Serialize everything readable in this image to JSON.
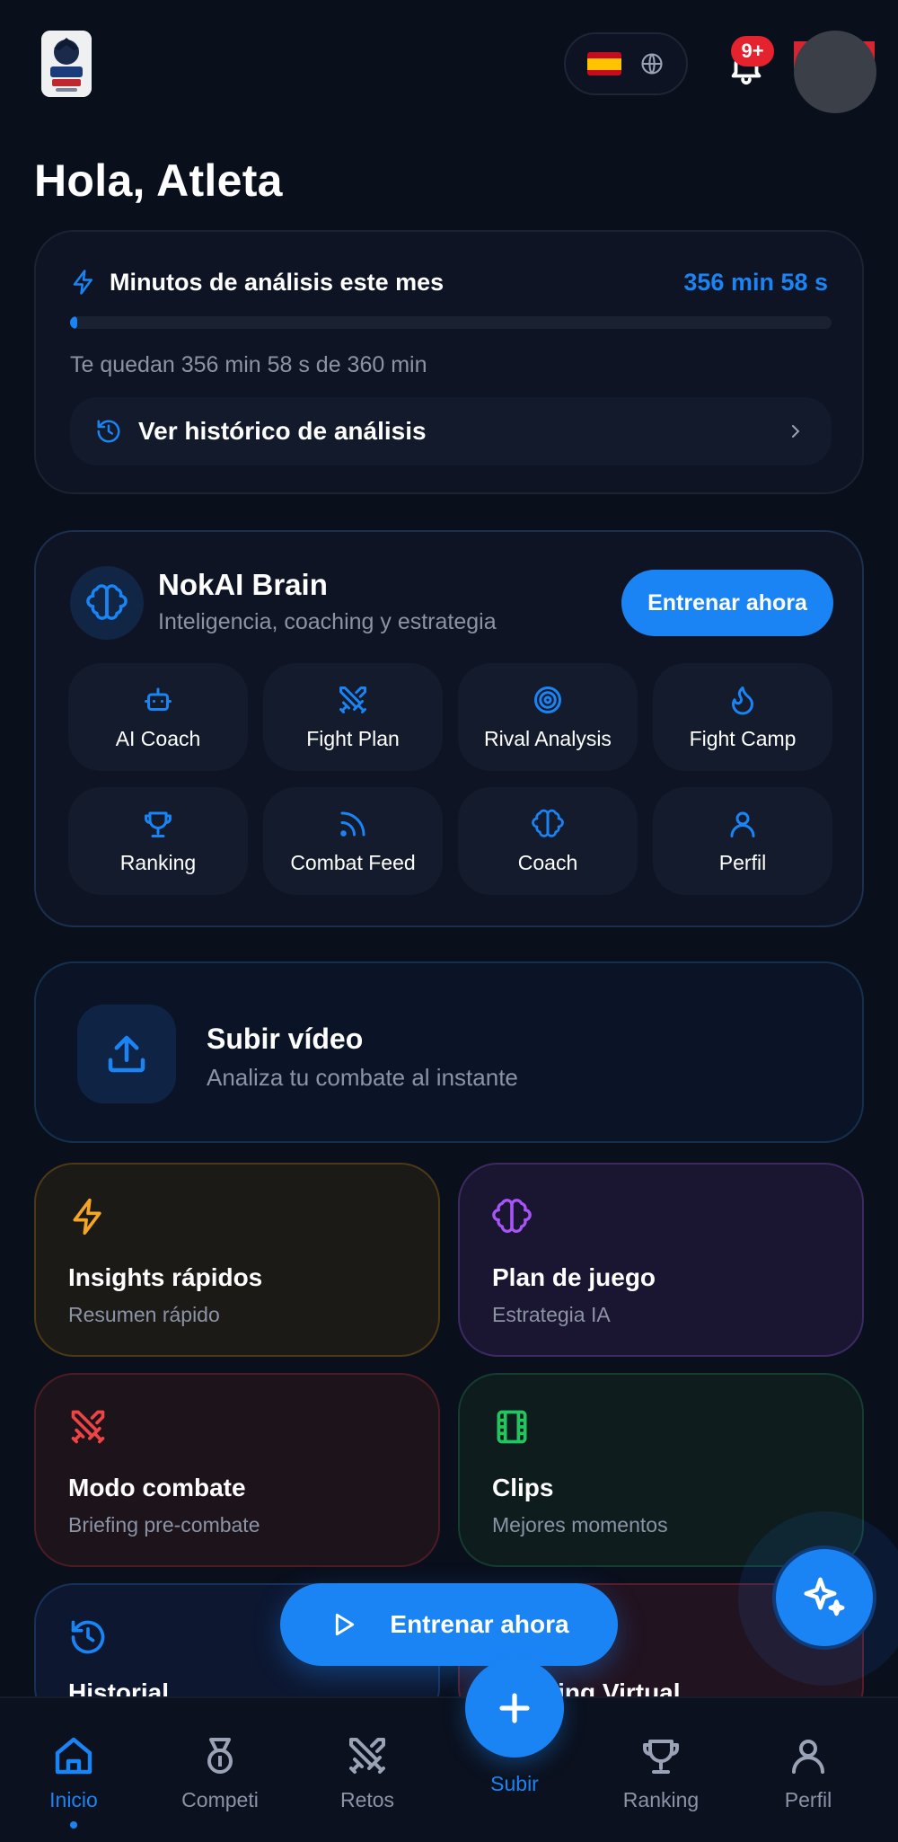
{
  "header": {
    "notifications_badge": "9+",
    "language_flag": "ES"
  },
  "greeting": "Hola, Atleta",
  "minutes": {
    "title": "Minutos de análisis este mes",
    "value": "356 min 58 s",
    "remaining_text": "Te quedan 356 min 58 s de 360 min",
    "used_fraction": 0.009,
    "history_label": "Ver histórico de análisis"
  },
  "brain": {
    "title": "NokAI Brain",
    "subtitle": "Inteligencia, coaching y estrategia",
    "train_button": "Entrenar ahora",
    "tiles": [
      {
        "label": "AI Coach",
        "icon": "robot-icon"
      },
      {
        "label": "Fight Plan",
        "icon": "swords-icon"
      },
      {
        "label": "Rival Analysis",
        "icon": "target-icon"
      },
      {
        "label": "Fight Camp",
        "icon": "flame-icon"
      },
      {
        "label": "Ranking",
        "icon": "trophy-icon"
      },
      {
        "label": "Combat Feed",
        "icon": "feed-icon"
      },
      {
        "label": "Coach",
        "icon": "brain-icon"
      },
      {
        "label": "Perfil",
        "icon": "user-icon"
      }
    ]
  },
  "upload": {
    "title": "Subir vídeo",
    "subtitle": "Analiza tu combate al instante"
  },
  "features": [
    {
      "title": "Insights rápidos",
      "subtitle": "Resumen rápido",
      "icon": "lightning-icon",
      "color": "#f5a524"
    },
    {
      "title": "Plan de juego",
      "subtitle": "Estrategia IA",
      "icon": "brain-icon",
      "color": "#a855f7"
    },
    {
      "title": "Modo combate",
      "subtitle": "Briefing pre-combate",
      "icon": "swords-icon",
      "color": "#ef4444"
    },
    {
      "title": "Clips",
      "subtitle": "Mejores momentos",
      "icon": "film-icon",
      "color": "#22c55e"
    },
    {
      "title": "Historial",
      "subtitle": "",
      "icon": "history-icon",
      "color": "#1b84f5"
    },
    {
      "title": "Sparring Virtual",
      "subtitle": "",
      "icon": "",
      "color": "#ef4444"
    }
  ],
  "floating_train_button": "Entrenar ahora",
  "nav": {
    "items": [
      {
        "label": "Inicio",
        "icon": "home-icon"
      },
      {
        "label": "Competi",
        "icon": "medal-icon"
      },
      {
        "label": "Retos",
        "icon": "swords-icon"
      },
      {
        "label": "Subir",
        "icon": "plus-icon"
      },
      {
        "label": "Ranking",
        "icon": "trophy-icon"
      },
      {
        "label": "Perfil",
        "icon": "user-icon"
      }
    ]
  },
  "colors": {
    "accent": "#1b84f5",
    "background": "#0a0f1c",
    "badge": "#e5232f"
  }
}
